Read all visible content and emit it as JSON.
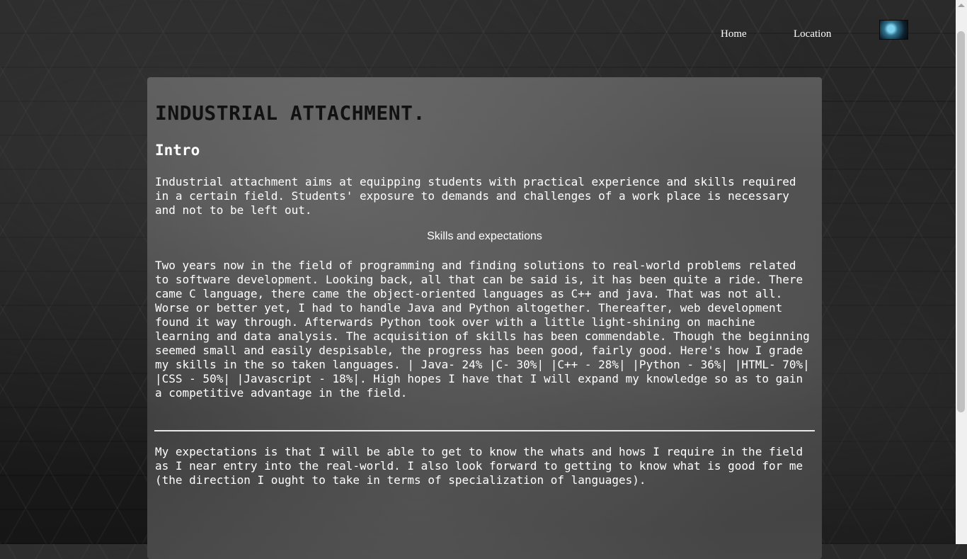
{
  "nav": {
    "home_label": "Home",
    "location_label": "Location",
    "avatar_icon": "profile-image-icon"
  },
  "main": {
    "title": "INDUSTRIAL ATTACHMENT.",
    "intro_heading": "Intro",
    "intro_text": "Industrial attachment aims at equipping students with practical experience and skills required in a certain field. Students' exposure to demands and challenges of a work place is necessary and not to be left out.",
    "skills_heading": "Skills and expectations",
    "skills_text": "Two years now in the field of programming and finding solutions to real-world problems related to software development. Looking back, all that can be said is, it has been quite a ride. There came C language, there came the object-oriented languages as C++ and java. That was not all. Worse or better yet, I had to handle Java and Python altogether. Thereafter, web development found it way through. Afterwards Python took over with a little light-shining on machine learning and data analysis. The acquisition of skills has been commendable. Though the beginning seemed small and easily despisable, the progress has been good, fairly good. Here's how I grade my skills in the so taken languages. | Java- 24% |C- 30%| |C++ - 28%| |Python - 36%| |HTML- 70%| |CSS - 50%| |Javascript - 18%|. High hopes I have that I will expand my knowledge so as to gain a competitive advantage in the field.",
    "expectations_text": "My expectations is that I will be able to get to know the whats and hows I require in the field as I near entry into the real-world. I also look forward to getting to know what is good for me (the direction I ought to take in terms of specialization of languages)."
  },
  "colors": {
    "title_color": "#111111",
    "text_color": "#ffffff",
    "panel_color": "#4a4a4a"
  }
}
